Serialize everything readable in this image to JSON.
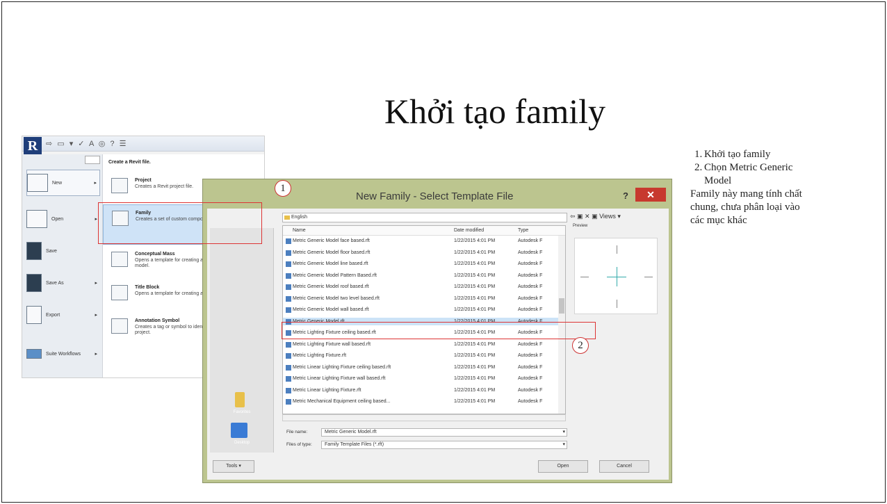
{
  "slide": {
    "title": "Khởi tạo family",
    "notes": {
      "steps": [
        {
          "num": "1.",
          "text": "Khởi tạo family"
        },
        {
          "num": "2.",
          "text": "Chọn Metric Generic Model"
        }
      ],
      "description": "Family này mang tính chất chung, chưa phân loại vào các mục khác"
    },
    "callouts": {
      "first": "1",
      "second": "2"
    }
  },
  "revit_menu": {
    "logo": "R",
    "qat_glyphs": "⇨ ▭ ▾ ✓ A ◎ ? ☰",
    "header": "Create a Revit file.",
    "commands": [
      {
        "label": "New",
        "arrow": "▸"
      },
      {
        "label": "Open",
        "arrow": "▸"
      },
      {
        "label": "Save",
        "arrow": ""
      },
      {
        "label": "Save As",
        "arrow": "▸"
      },
      {
        "label": "Export",
        "arrow": "▸"
      },
      {
        "label": "Suite Workflows",
        "arrow": "▸"
      }
    ],
    "items": [
      {
        "title": "Project",
        "desc": "Creates a Revit project file."
      },
      {
        "title": "Family",
        "desc": "Creates a set of custom components to use in projects."
      },
      {
        "title": "Conceptual Mass",
        "desc": "Opens a template for creating a conceptual massing model."
      },
      {
        "title": "Title Block",
        "desc": "Opens a template for creating a Title Block family."
      },
      {
        "title": "Annotation Symbol",
        "desc": "Creates a tag or symbol to identify elements in the project."
      }
    ]
  },
  "dialog": {
    "title": "New Family - Select Template File",
    "help": "?",
    "close": "✕",
    "look_in": "English",
    "nav_tools": "⇦ ▣ ✕ ▣ Views ▾",
    "preview_label": "Preview",
    "columns": {
      "name": "Name",
      "date": "Date modified",
      "type": "Type"
    },
    "files": [
      {
        "name": "Metric Generic Model face based.rft",
        "date": "1/22/2015 4:01 PM",
        "type": "Autodesk F"
      },
      {
        "name": "Metric Generic Model floor based.rft",
        "date": "1/22/2015 4:01 PM",
        "type": "Autodesk F"
      },
      {
        "name": "Metric Generic Model line based.rft",
        "date": "1/22/2015 4:01 PM",
        "type": "Autodesk F"
      },
      {
        "name": "Metric Generic Model Pattern Based.rft",
        "date": "1/22/2015 4:01 PM",
        "type": "Autodesk F"
      },
      {
        "name": "Metric Generic Model roof based.rft",
        "date": "1/22/2015 4:01 PM",
        "type": "Autodesk F"
      },
      {
        "name": "Metric Generic Model two level based.rft",
        "date": "1/22/2015 4:01 PM",
        "type": "Autodesk F"
      },
      {
        "name": "Metric Generic Model wall based.rft",
        "date": "1/22/2015 4:01 PM",
        "type": "Autodesk F"
      },
      {
        "name": "Metric Generic Model.rft",
        "date": "1/22/2015 4:01 PM",
        "type": "Autodesk F"
      },
      {
        "name": "Metric Lighting Fixture ceiling based.rft",
        "date": "1/22/2015 4:01 PM",
        "type": "Autodesk F"
      },
      {
        "name": "Metric Lighting Fixture wall based.rft",
        "date": "1/22/2015 4:01 PM",
        "type": "Autodesk F"
      },
      {
        "name": "Metric Lighting Fixture.rft",
        "date": "1/22/2015 4:01 PM",
        "type": "Autodesk F"
      },
      {
        "name": "Metric Linear Lighting Fixture ceiling based.rft",
        "date": "1/22/2015 4:01 PM",
        "type": "Autodesk F"
      },
      {
        "name": "Metric Linear Lighting Fixture wall based.rft",
        "date": "1/22/2015 4:01 PM",
        "type": "Autodesk F"
      },
      {
        "name": "Metric Linear Lighting Fixture.rft",
        "date": "1/22/2015 4:01 PM",
        "type": "Autodesk F"
      },
      {
        "name": "Metric Mechanical Equipment ceiling based...",
        "date": "1/22/2015 4:01 PM",
        "type": "Autodesk F"
      }
    ],
    "places": [
      {
        "label": "Favorites"
      },
      {
        "label": "Desktop"
      }
    ],
    "file_name_label": "File name:",
    "file_name_value": "Metric Generic Model.rft",
    "file_type_label": "Files of type:",
    "file_type_value": "Family Template Files (*.rft)",
    "tools_label": "Tools",
    "open_label": "Open",
    "cancel_label": "Cancel"
  },
  "colors": {
    "accent_red": "#d33333",
    "selection": "#cce3f7",
    "dialog_frame": "#bcc58f",
    "close_red": "#c7392e"
  }
}
